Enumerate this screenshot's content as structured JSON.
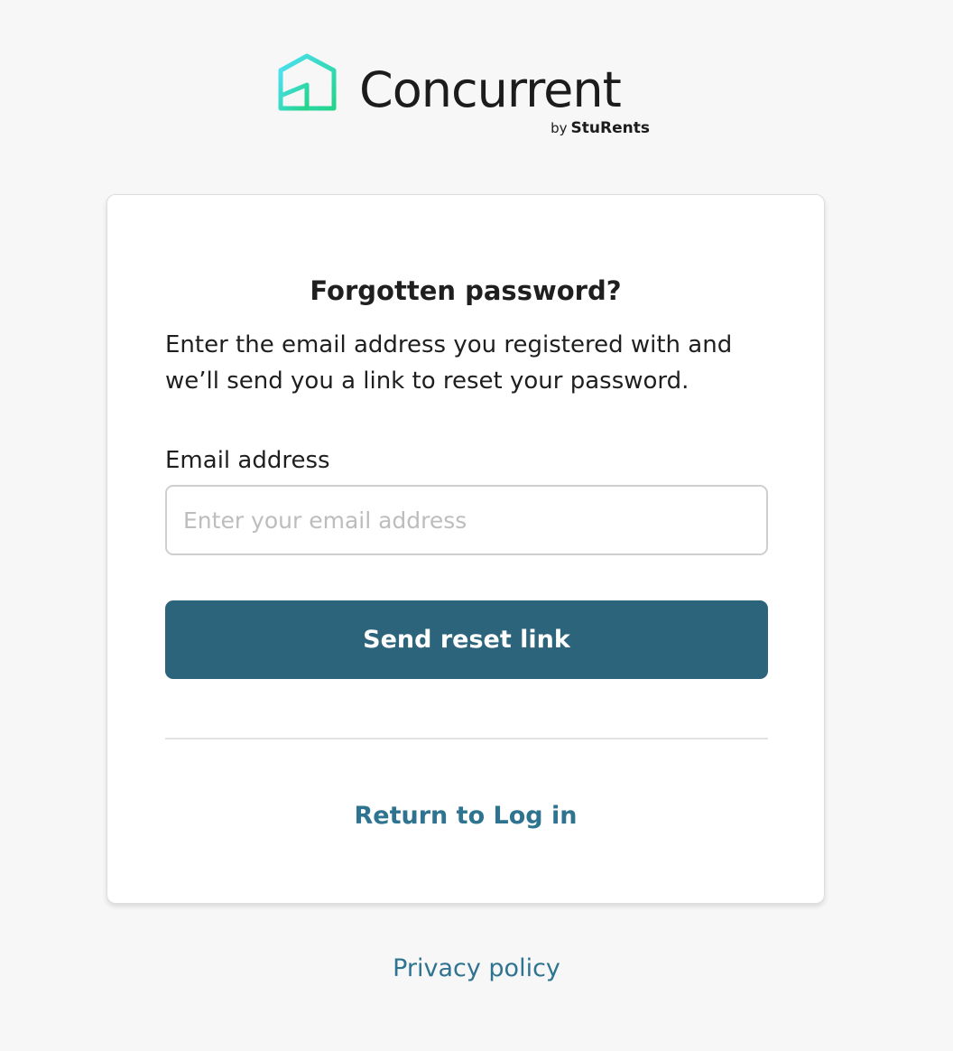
{
  "logo": {
    "wordmark": "Concurrent",
    "by": "by",
    "brand": "StuRents",
    "icon": "house-icon",
    "gradient_colors": [
      "#4ce0f2",
      "#23d48a"
    ]
  },
  "card": {
    "title": "Forgotten password?",
    "description": "Enter the email address you registered with and we’ll send you a link to reset your password.",
    "email_label": "Email address",
    "email_placeholder": "Enter your email address",
    "email_value": "",
    "submit_label": "Send reset link",
    "return_link": "Return to Log in"
  },
  "footer": {
    "privacy_link": "Privacy policy"
  },
  "colors": {
    "primary_button": "#2c647b",
    "link": "#2e7390",
    "background": "#f7f7f7"
  }
}
